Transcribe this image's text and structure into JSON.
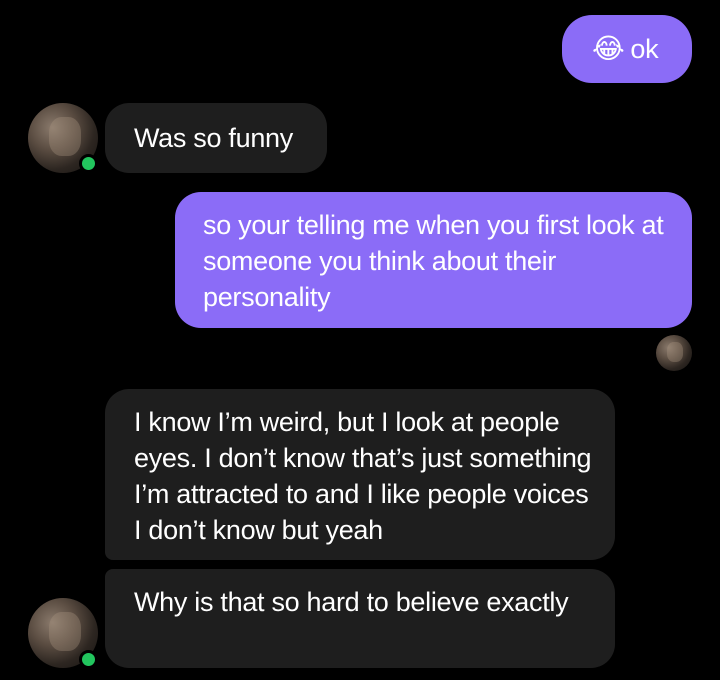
{
  "messages": [
    {
      "direction": "outgoing",
      "emoji": "😂",
      "text": "ok"
    },
    {
      "direction": "incoming",
      "text": "Was so funny"
    },
    {
      "direction": "outgoing",
      "text": "so your telling me when you first look at someone you think about their personality"
    },
    {
      "direction": "incoming",
      "text": "I know I’m weird, but I look at people eyes. I don’t know that’s just something I’m attracted to and I like people voices I don’t know but yeah"
    },
    {
      "direction": "incoming",
      "text": "Why is that so hard to believe exactly"
    }
  ],
  "colors": {
    "background": "#000000",
    "outgoing_bubble": "#8b6cf7",
    "incoming_bubble": "#1e1e1e",
    "online_indicator": "#22c55e",
    "text": "#ffffff"
  },
  "icons": {
    "avatar": "contact-avatar-photo",
    "online": "online-status-dot",
    "read_receipt": "read-receipt-avatar"
  }
}
